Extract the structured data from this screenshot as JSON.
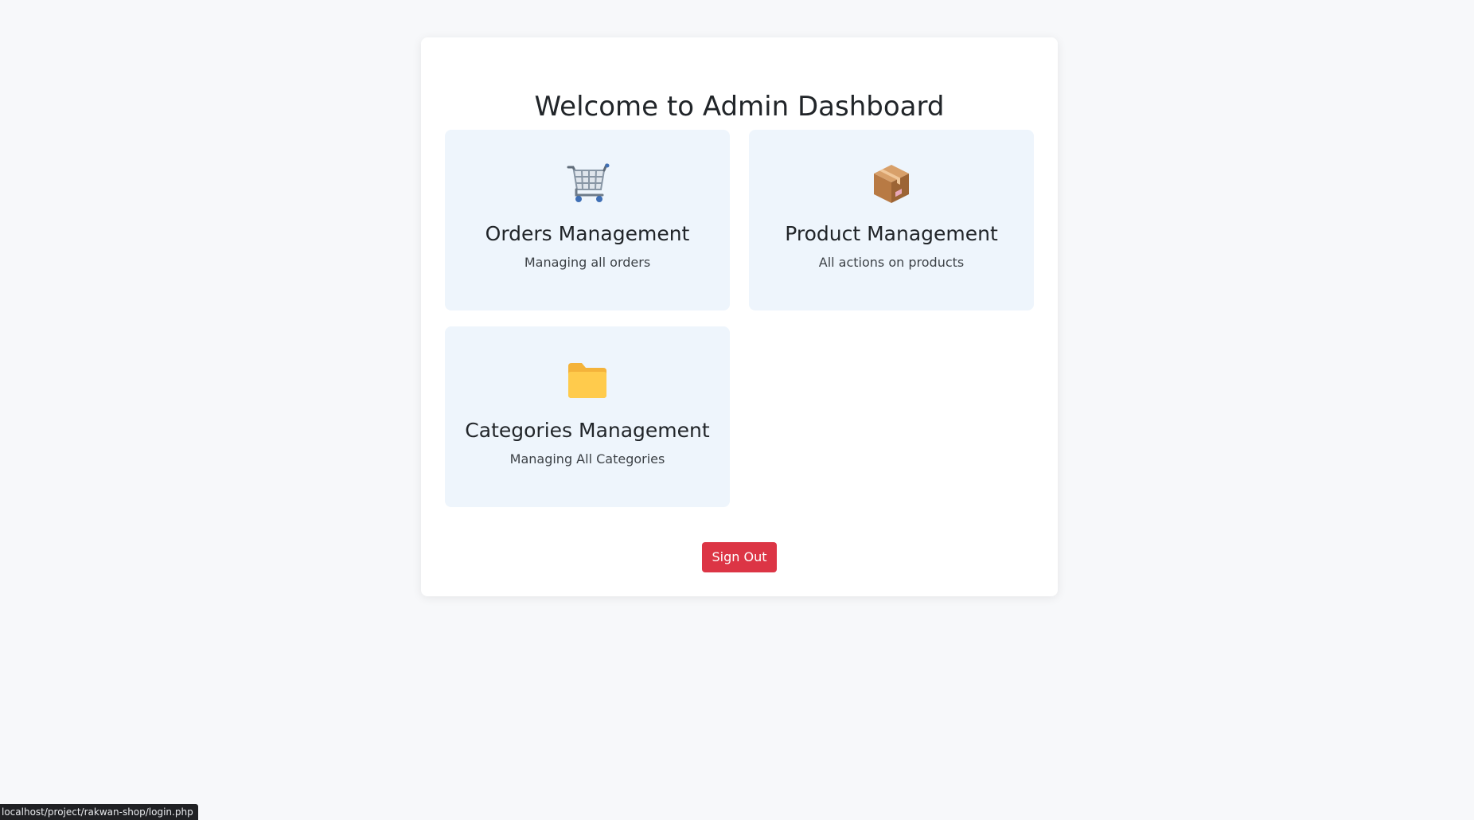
{
  "page": {
    "title": "Welcome to Admin Dashboard"
  },
  "cards": [
    {
      "icon": "shopping-cart-icon",
      "title": "Orders Management",
      "description": "Managing all orders"
    },
    {
      "icon": "package-box-icon",
      "title": "Product Management",
      "description": "All actions on products"
    },
    {
      "icon": "folder-icon",
      "title": "Categories Management",
      "description": "Managing All Categories"
    }
  ],
  "actions": {
    "signout_label": "Sign Out"
  },
  "status_bar": {
    "url": "localhost/project/rakwan-shop/login.php"
  },
  "colors": {
    "page_background": "#f7f8fa",
    "card_background": "#eef5fc",
    "signout_button": "#dc3545"
  }
}
